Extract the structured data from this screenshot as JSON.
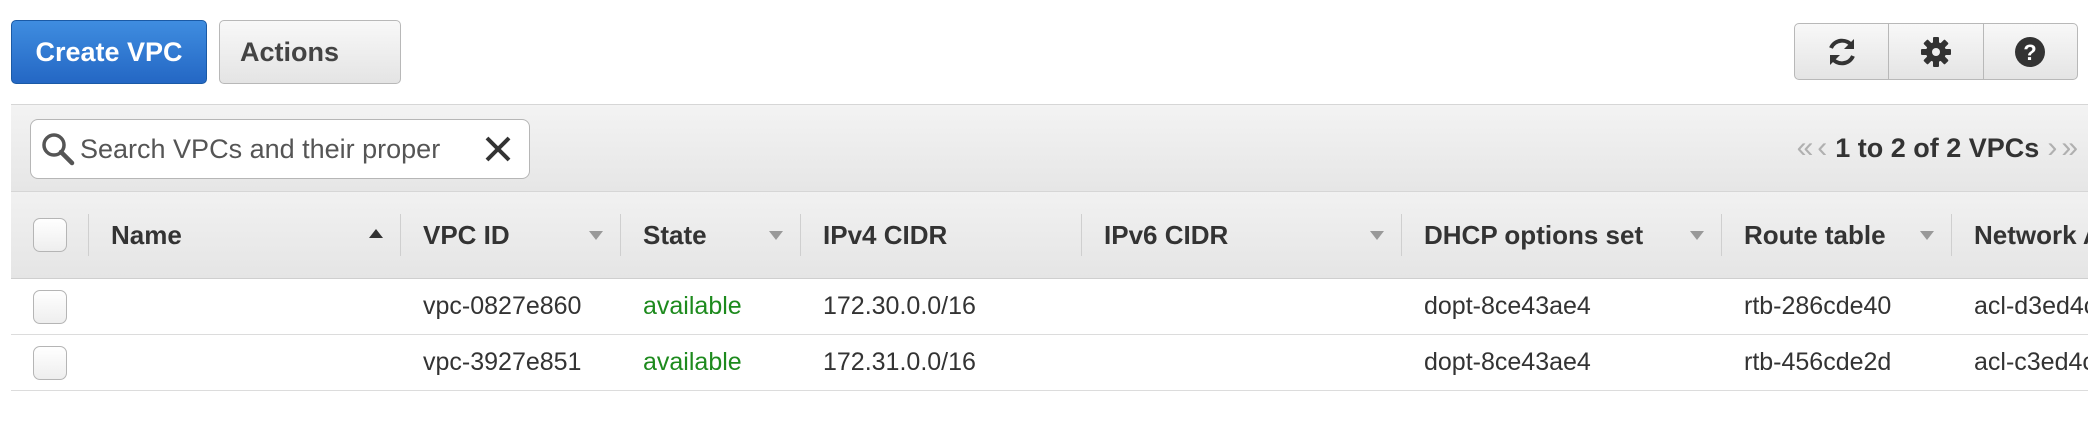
{
  "toolbar": {
    "create_label": "Create VPC",
    "actions_label": "Actions",
    "icons": [
      "refresh-icon",
      "gear-icon",
      "help-icon"
    ]
  },
  "filter": {
    "search_placeholder": "Search VPCs and their proper",
    "pagination": "1 to 2 of 2 VPCs"
  },
  "table": {
    "columns": [
      "Name",
      "VPC ID",
      "State",
      "IPv4 CIDR",
      "IPv6 CIDR",
      "DHCP options set",
      "Route table",
      "Network A"
    ],
    "rows": [
      {
        "name": "",
        "vpc_id": "vpc-0827e860",
        "state": "available",
        "ipv4_cidr": "172.30.0.0/16",
        "ipv6_cidr": "",
        "dhcp_options": "dopt-8ce43ae4",
        "route_table": "rtb-286cde40",
        "network_acl": "acl-d3ed4c"
      },
      {
        "name": "",
        "vpc_id": "vpc-3927e851",
        "state": "available",
        "ipv4_cidr": "172.31.0.0/16",
        "ipv6_cidr": "",
        "dhcp_options": "dopt-8ce43ae4",
        "route_table": "rtb-456cde2d",
        "network_acl": "acl-c3ed4c"
      }
    ]
  },
  "colors": {
    "primary_button": "#2467c4",
    "state_available": "#1d8a1d"
  }
}
